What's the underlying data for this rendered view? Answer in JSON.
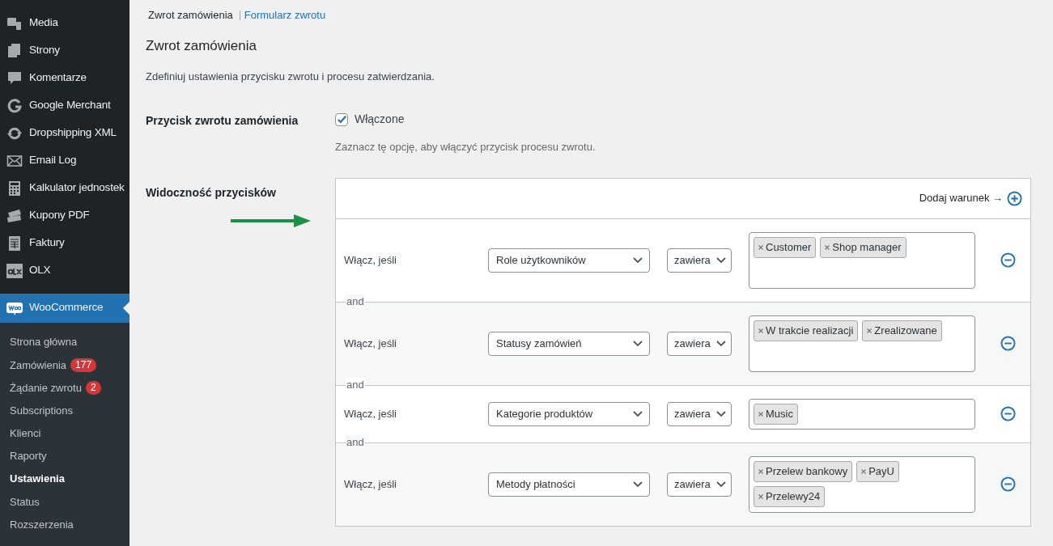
{
  "sidebar": {
    "items": [
      {
        "label": "Media",
        "selected": false
      },
      {
        "label": "Strony",
        "selected": false
      },
      {
        "label": "Komentarze",
        "selected": false
      },
      {
        "label": "Google Merchant",
        "selected": false
      },
      {
        "label": "Dropshipping XML",
        "selected": false
      },
      {
        "label": "Email Log",
        "selected": false
      },
      {
        "label": "Kalkulator jednostek",
        "selected": false
      },
      {
        "label": "Kupony PDF",
        "selected": false
      },
      {
        "label": "Faktury",
        "selected": false
      },
      {
        "label": "OLX",
        "selected": false
      },
      {
        "label": "WooCommerce",
        "selected": true
      }
    ],
    "submenu": [
      {
        "label": "Strona główna",
        "selected": false
      },
      {
        "label": "Zamówienia",
        "badge": "177",
        "selected": false
      },
      {
        "label": "Żądanie zwrotu",
        "badge": "2",
        "selected": false
      },
      {
        "label": "Subscriptions",
        "selected": false
      },
      {
        "label": "Klienci",
        "selected": false
      },
      {
        "label": "Raporty",
        "selected": false
      },
      {
        "label": "Ustawienia",
        "selected": true
      },
      {
        "label": "Status",
        "selected": false
      },
      {
        "label": "Rozszerzenia",
        "selected": false
      }
    ]
  },
  "subnav": [
    {
      "label": "Zwrot zamówienia",
      "selected": true
    },
    {
      "label": "Formularz zwrotu",
      "selected": false
    }
  ],
  "heading": "Zwrot zamówienia",
  "description": "Zdefiniuj ustawienia przycisku zwrotu i procesu zatwierdzania.",
  "return_button": {
    "label": "Przycisk zwrotu zamówienia",
    "checkbox_label": "Włączone",
    "checked": true,
    "hint": "Zaznacz tę opcję, aby włączyć przycisk procesu zwrotu."
  },
  "visibility": {
    "label": "Widoczność przycisków",
    "add_label": "Dodaj warunek →",
    "conditions": [
      {
        "label": "Włącz, jeśli",
        "field": "Role użytkowników",
        "operator": "zawiera",
        "values": [
          "Customer",
          "Shop manager"
        ]
      },
      {
        "joiner": "and",
        "label": "Włącz, jeśli",
        "field": "Statusy zamówień",
        "operator": "zawiera",
        "values": [
          "W trakcie realizacji",
          "Zrealizowane"
        ]
      },
      {
        "joiner": "and",
        "label": "Włącz, jeśli",
        "field": "Kategorie produktów",
        "operator": "zawiera",
        "values": [
          "Music"
        ]
      },
      {
        "joiner": "and",
        "label": "Włącz, jeśli",
        "field": "Metody płatności",
        "operator": "zawiera",
        "values": [
          "Przelew bankowy",
          "PayU",
          "Przelewy24"
        ]
      }
    ]
  }
}
